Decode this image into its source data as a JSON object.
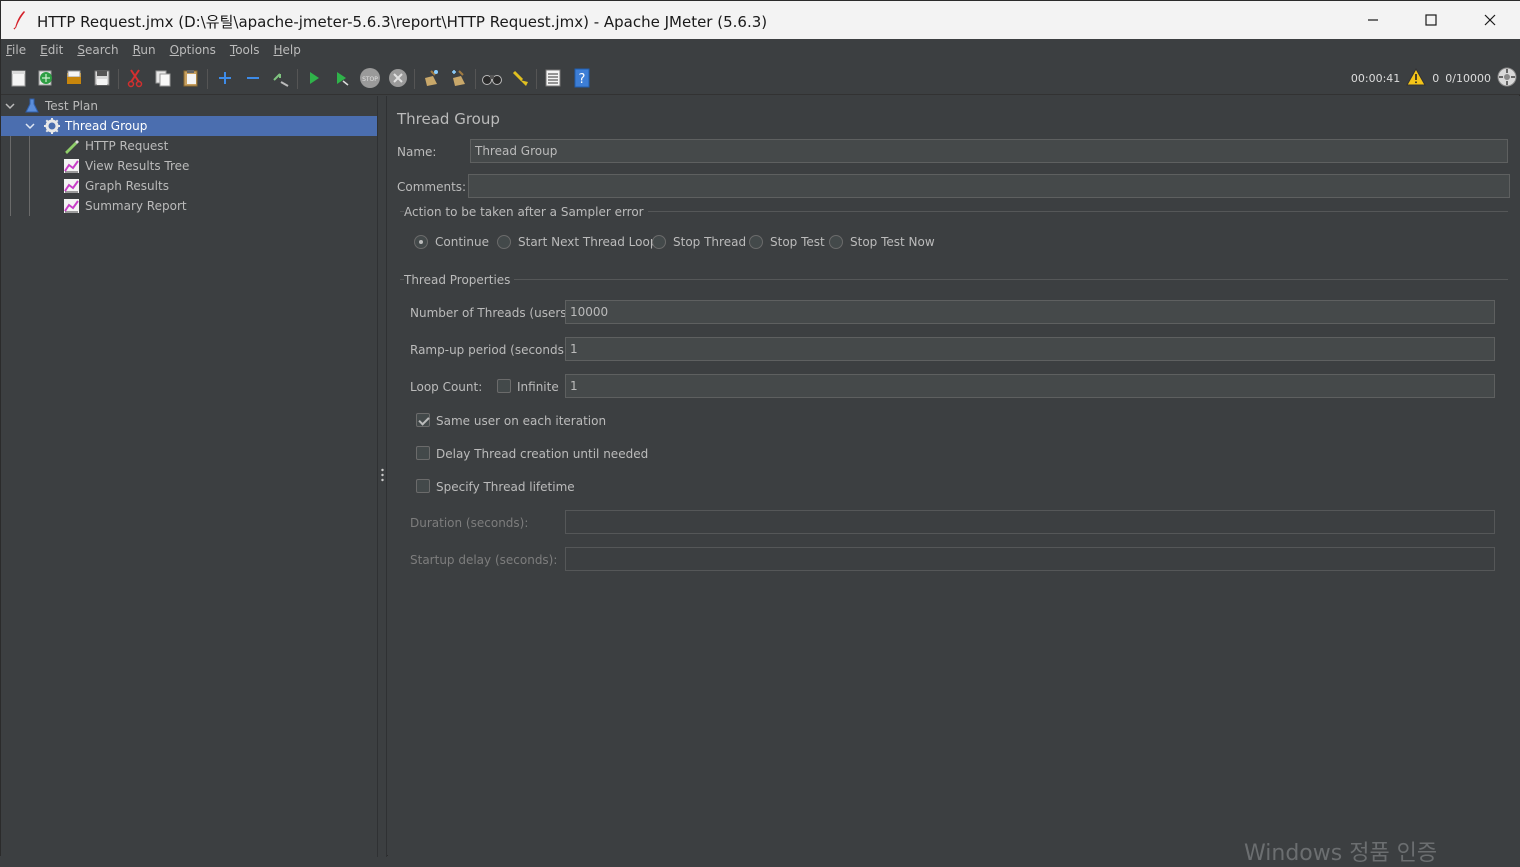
{
  "window": {
    "title": "HTTP Request.jmx (D:\\유틸\\apache-jmeter-5.6.3\\report\\HTTP Request.jmx) - Apache JMeter (5.6.3)"
  },
  "menu": [
    {
      "label": "File",
      "ul": "F",
      "rest": "ile"
    },
    {
      "label": "Edit",
      "ul": "E",
      "rest": "dit"
    },
    {
      "label": "Search",
      "ul": "S",
      "rest": "earch"
    },
    {
      "label": "Run",
      "ul": "R",
      "rest": "un"
    },
    {
      "label": "Options",
      "ul": "O",
      "rest": "ptions"
    },
    {
      "label": "Tools",
      "ul": "T",
      "rest": "ools"
    },
    {
      "label": "Help",
      "ul": "H",
      "rest": "elp"
    }
  ],
  "toolbar": {
    "icons": [
      "new-icon",
      "templates-icon",
      "open-icon",
      "save-icon",
      "cut-icon",
      "copy-icon",
      "paste-icon",
      "expand-icon",
      "collapse-icon",
      "toggle-icon",
      "start-icon",
      "start-no-pause-icon",
      "stop-icon",
      "shutdown-icon",
      "clear-icon",
      "clear-all-icon",
      "search-icon",
      "reset-search-icon",
      "function-helper-icon",
      "help-icon"
    ]
  },
  "status": {
    "elapsed": "00:00:41",
    "warnings": "0",
    "threads": "0/10000"
  },
  "tree": {
    "items": [
      {
        "label": "Test Plan",
        "icon": "test-plan-icon"
      },
      {
        "label": "Thread Group",
        "icon": "gear-icon",
        "selected": true
      },
      {
        "label": "HTTP Request",
        "icon": "sampler-pen-icon"
      },
      {
        "label": "View Results Tree",
        "icon": "listener-chart-icon"
      },
      {
        "label": "Graph Results",
        "icon": "listener-chart-icon"
      },
      {
        "label": "Summary Report",
        "icon": "listener-chart-icon"
      }
    ]
  },
  "panel": {
    "heading": "Thread Group",
    "name_label": "Name:",
    "name_value": "Thread Group",
    "comments_label": "Comments:",
    "comments_value": "",
    "error_section": "Action to be taken after a Sampler error",
    "error_options": [
      {
        "label": "Continue",
        "selected": true
      },
      {
        "label": "Start Next Thread Loop",
        "selected": false
      },
      {
        "label": "Stop Thread",
        "selected": false
      },
      {
        "label": "Stop Test",
        "selected": false
      },
      {
        "label": "Stop Test Now",
        "selected": false
      }
    ],
    "props_section": "Thread Properties",
    "threads_label": "Number of Threads (users):",
    "threads_value": "10000",
    "rampup_label": "Ramp-up period (seconds):",
    "rampup_value": "1",
    "loop_label": "Loop Count:",
    "infinite_label": "Infinite",
    "infinite_checked": false,
    "loop_value": "1",
    "same_user_label": "Same user on each iteration",
    "same_user_checked": true,
    "delay_label": "Delay Thread creation until needed",
    "delay_checked": false,
    "lifetime_label": "Specify Thread lifetime",
    "lifetime_checked": false,
    "duration_label": "Duration (seconds):",
    "duration_value": "",
    "startup_label": "Startup delay (seconds):",
    "startup_value": ""
  },
  "watermark": "Windows 정품 인증"
}
